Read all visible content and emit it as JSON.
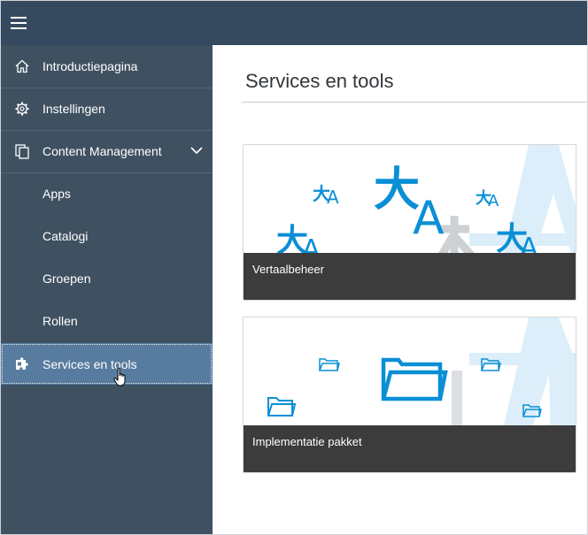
{
  "header": {
    "menu_icon": "hamburger-icon"
  },
  "sidebar": {
    "items": [
      {
        "label": "Introductiepagina",
        "icon": "home-icon"
      },
      {
        "label": "Instellingen",
        "icon": "gear-icon"
      },
      {
        "label": "Content Management",
        "icon": "copy-icon",
        "expanded": true
      },
      {
        "label": "Apps"
      },
      {
        "label": "Catalogi"
      },
      {
        "label": "Groepen"
      },
      {
        "label": "Rollen"
      },
      {
        "label": "Services en tools",
        "icon": "puzzle-icon",
        "selected": true
      }
    ]
  },
  "main": {
    "title": "Services en tools",
    "tiles": [
      {
        "label": "Vertaalbeheer",
        "icon": "translate-icon"
      },
      {
        "label": "Implementatie pakket",
        "icon": "folder-icon"
      }
    ]
  },
  "colors": {
    "shell": "#354a5f",
    "sidebar": "#3f5161",
    "selected": "#587c9f",
    "accent": "#0a8fd6",
    "caption": "#3c3c3c"
  }
}
